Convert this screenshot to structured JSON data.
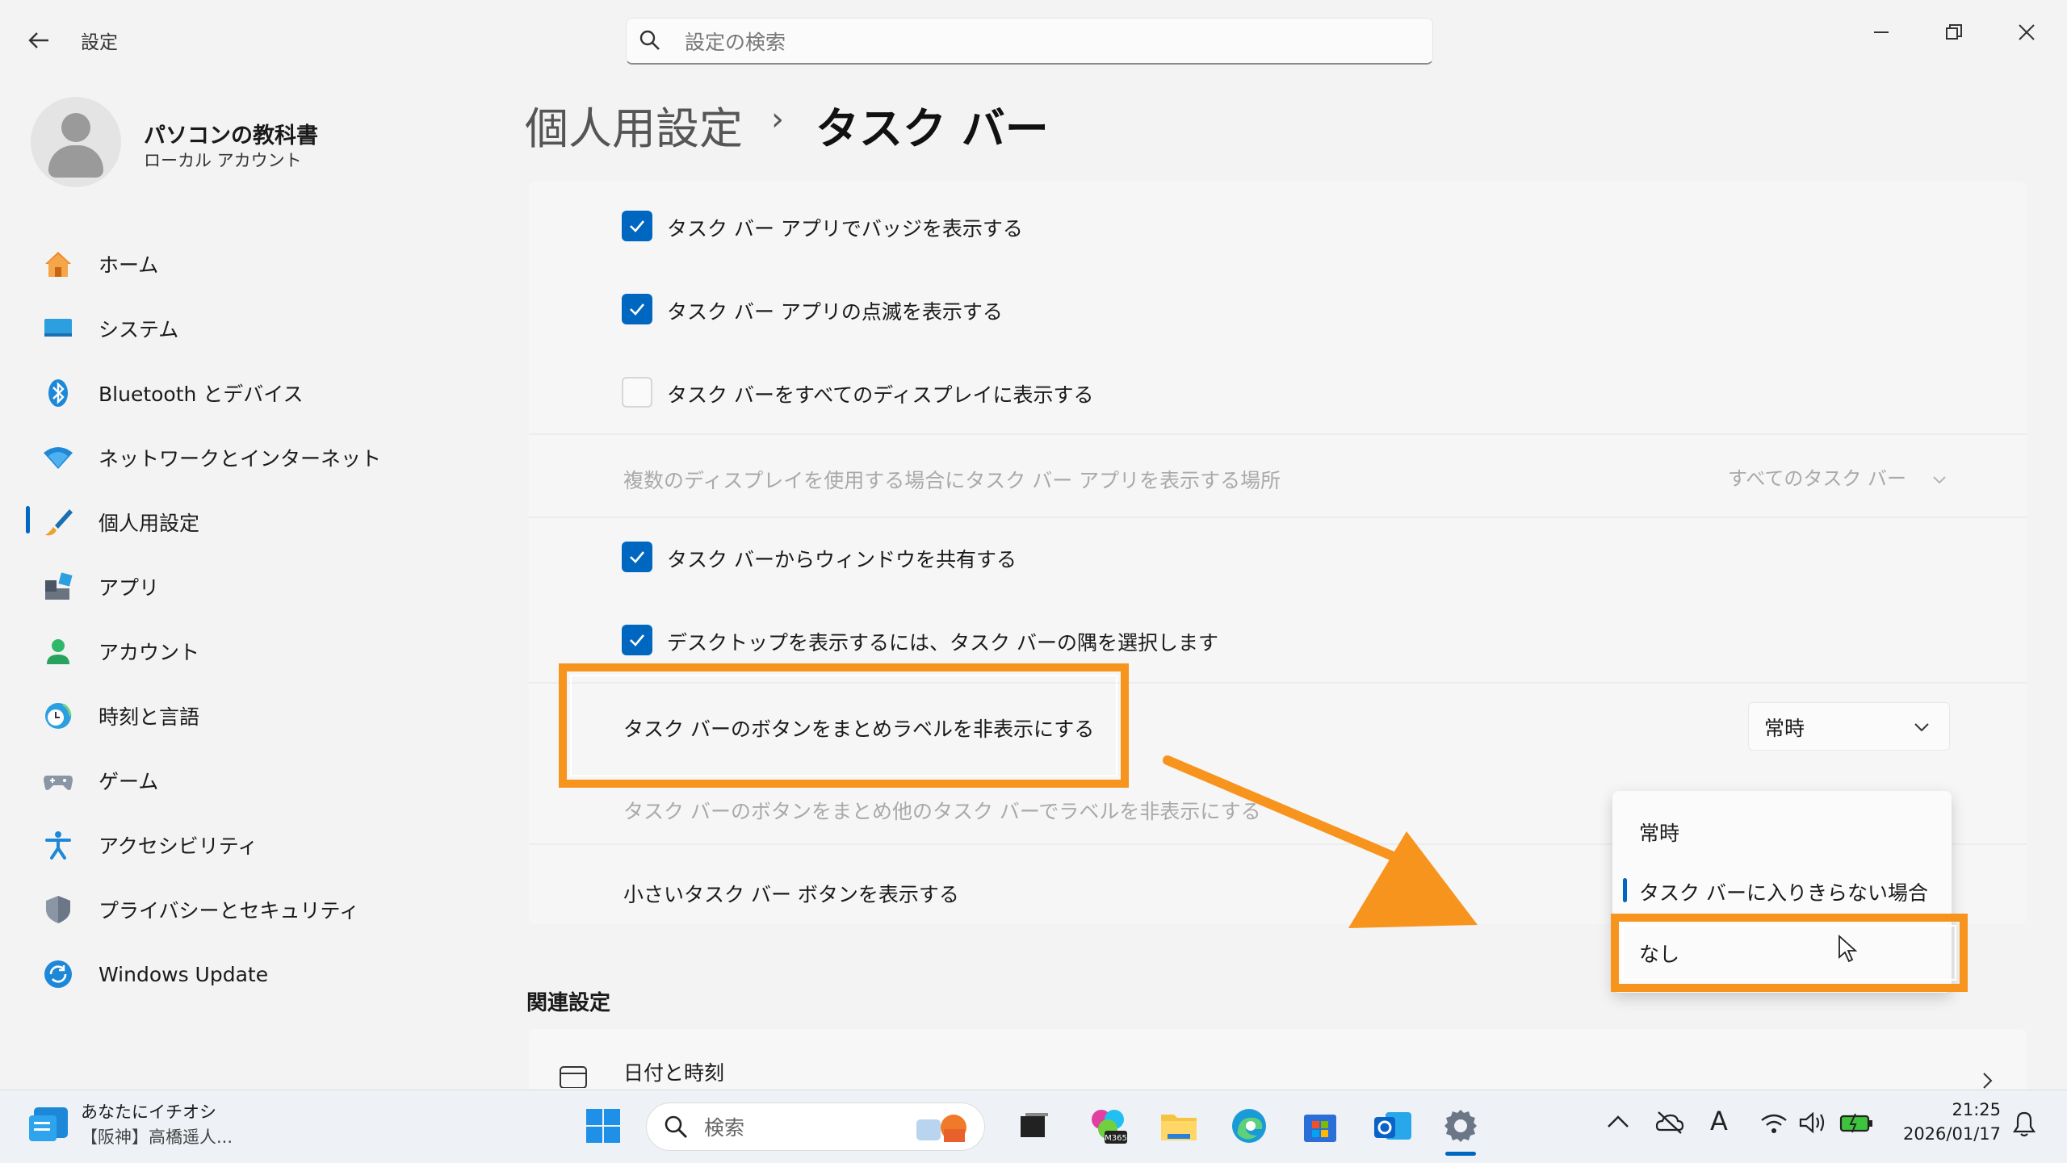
{
  "window": {
    "title": "設定",
    "search_placeholder": "設定の検索"
  },
  "profile": {
    "name": "パソコンの教科書",
    "account_type": "ローカル アカウント"
  },
  "sidebar": {
    "items": [
      {
        "label": "ホーム",
        "icon": "home-icon"
      },
      {
        "label": "システム",
        "icon": "system-icon"
      },
      {
        "label": "Bluetooth とデバイス",
        "icon": "bluetooth-icon"
      },
      {
        "label": "ネットワークとインターネット",
        "icon": "wifi-icon"
      },
      {
        "label": "個人用設定",
        "icon": "brush-icon",
        "active": true
      },
      {
        "label": "アプリ",
        "icon": "apps-icon"
      },
      {
        "label": "アカウント",
        "icon": "account-icon"
      },
      {
        "label": "時刻と言語",
        "icon": "globe-clock-icon"
      },
      {
        "label": "ゲーム",
        "icon": "gamepad-icon"
      },
      {
        "label": "アクセシビリティ",
        "icon": "accessibility-icon"
      },
      {
        "label": "プライバシーとセキュリティ",
        "icon": "shield-icon"
      },
      {
        "label": "Windows Update",
        "icon": "update-icon"
      }
    ]
  },
  "breadcrumb": {
    "parent": "個人用設定",
    "separator": "›",
    "current": "タスク バー"
  },
  "settings": {
    "show_badges": {
      "label": "タスク バー アプリでバッジを表示する",
      "checked": true
    },
    "show_flashing": {
      "label": "タスク バー アプリの点滅を表示する",
      "checked": true
    },
    "show_all_displays": {
      "label": "タスク バーをすべてのディスプレイに表示する",
      "checked": false
    },
    "multi_display_location": {
      "label": "複数のディスプレイを使用する場合にタスク バー アプリを表示する場所",
      "value": "すべてのタスク バー"
    },
    "share_window": {
      "label": "タスク バーからウィンドウを共有する",
      "checked": true
    },
    "far_corner_desktop": {
      "label": "デスクトップを表示するには、タスク バーの隅を選択します",
      "checked": true
    },
    "combine_buttons": {
      "label": "タスク バーのボタンをまとめラベルを非表示にする",
      "value": "常時"
    },
    "combine_other": {
      "label": "タスク バーのボタンをまとめ他のタスク バーでラベルを非表示にする"
    },
    "small_buttons": {
      "label": "小さいタスク バー ボタンを表示する"
    }
  },
  "dropdown_options": [
    "常時",
    "タスク バーに入りきらない場合",
    "なし"
  ],
  "related": {
    "title": "関連設定",
    "date_time": "日付と時刻"
  },
  "taskbar": {
    "news_title": "あなたにイチオシ",
    "news_sub": "【阪神】高橋遥人...",
    "search_label": "検索",
    "time": "21:25",
    "date": "2026/01/17",
    "ime_indicator": "A"
  },
  "colors": {
    "accent": "#0067c0",
    "highlight": "#f7941d"
  }
}
